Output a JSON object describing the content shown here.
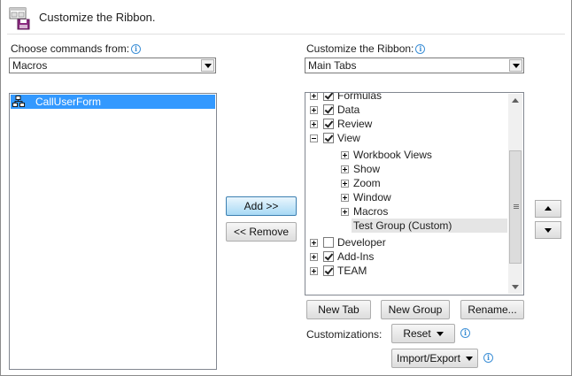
{
  "header": {
    "title": "Customize the Ribbon."
  },
  "left": {
    "label": "Choose commands from:",
    "combo_value": "Macros",
    "list": [
      {
        "label": "CallUserForm",
        "icon": "macro-icon",
        "selected": true
      }
    ]
  },
  "middle": {
    "add_label": "Add >>",
    "remove_label": "<< Remove"
  },
  "right": {
    "label": "Customize the Ribbon:",
    "combo_value": "Main Tabs",
    "tree": [
      {
        "label": "Formulas",
        "expand": "plus",
        "checked": true,
        "level": 0
      },
      {
        "label": "Data",
        "expand": "plus",
        "checked": true,
        "level": 0
      },
      {
        "label": "Review",
        "expand": "plus",
        "checked": true,
        "level": 0
      },
      {
        "label": "View",
        "expand": "minus",
        "checked": true,
        "level": 0
      },
      {
        "label": "Workbook Views",
        "expand": "plus",
        "level": 1
      },
      {
        "label": "Show",
        "expand": "plus",
        "level": 1
      },
      {
        "label": "Zoom",
        "expand": "plus",
        "level": 1
      },
      {
        "label": "Window",
        "expand": "plus",
        "level": 1
      },
      {
        "label": "Macros",
        "expand": "plus",
        "level": 1
      },
      {
        "label": "Test Group (Custom)",
        "level": 1,
        "highlight": true
      },
      {
        "label": "Developer",
        "expand": "plus",
        "checked": false,
        "level": 0
      },
      {
        "label": "Add-Ins",
        "expand": "plus",
        "checked": true,
        "level": 0
      },
      {
        "label": "TEAM",
        "expand": "plus",
        "checked": true,
        "level": 0
      }
    ],
    "new_tab_label": "New Tab",
    "new_group_label": "New Group",
    "rename_label": "Rename...",
    "customizations_label": "Customizations:",
    "reset_label": "Reset",
    "import_export_label": "Import/Export"
  }
}
